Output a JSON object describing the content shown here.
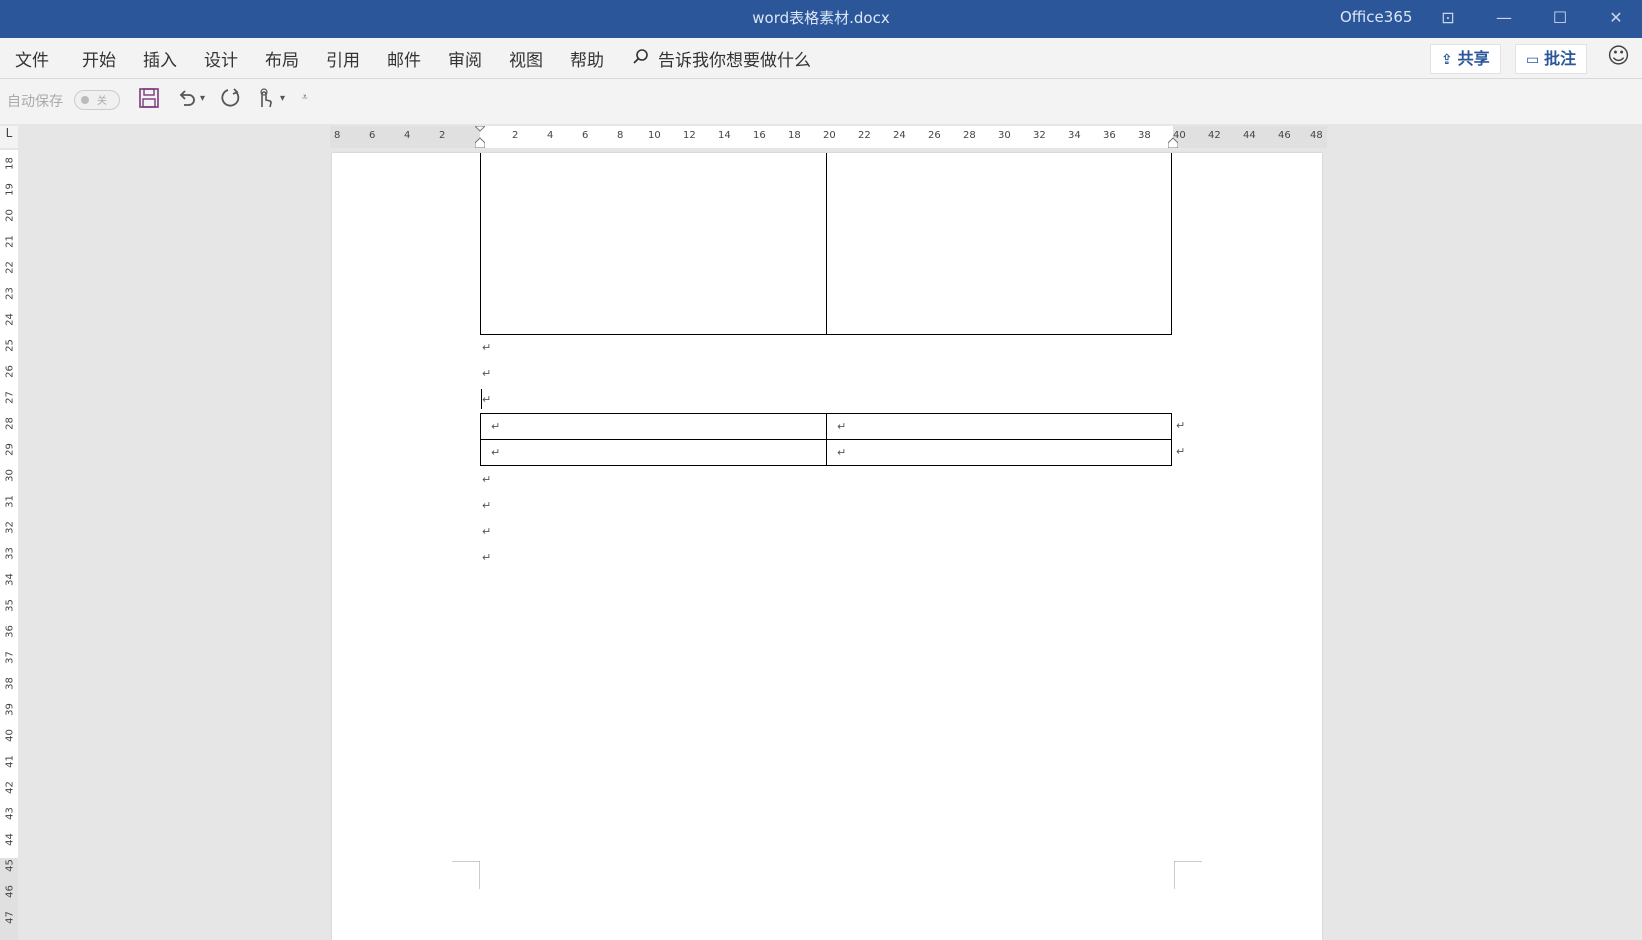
{
  "window": {
    "title": "word表格素材.docx",
    "brand": "Office365",
    "buttons": {
      "ribbon_display": "⊡",
      "minimize": "—",
      "maximize": "☐",
      "close": "✕"
    }
  },
  "menu": {
    "items": [
      "文件",
      "开始",
      "插入",
      "设计",
      "布局",
      "引用",
      "邮件",
      "审阅",
      "视图",
      "帮助"
    ],
    "tell_me": "告诉我你想要做什么",
    "share": "共享",
    "comments": "批注"
  },
  "qat": {
    "autosave_label": "自动保存",
    "autosave_state": "关",
    "icons": [
      "save-icon",
      "undo-icon",
      "redo-icon",
      "touch-mode-icon",
      "customize-qat-icon"
    ]
  },
  "ruler": {
    "horizontal_labels": [
      "8",
      "6",
      "4",
      "2",
      "2",
      "4",
      "6",
      "8",
      "10",
      "12",
      "14",
      "16",
      "18",
      "20",
      "22",
      "24",
      "26",
      "28",
      "30",
      "32",
      "34",
      "36",
      "38",
      "40",
      "42",
      "44",
      "46",
      "48"
    ],
    "vertical_labels": [
      "18",
      "19",
      "20",
      "21",
      "22",
      "23",
      "24",
      "25",
      "26",
      "27",
      "28",
      "29",
      "30",
      "31",
      "32",
      "33",
      "34",
      "35",
      "36",
      "37",
      "38",
      "39",
      "40",
      "41",
      "42",
      "43",
      "44",
      "45",
      "46",
      "47"
    ],
    "corner": "L"
  },
  "document": {
    "paragraph_mark": "↵",
    "colors": {
      "titlebar": "#2b579a",
      "accent": "#2b579a"
    }
  }
}
